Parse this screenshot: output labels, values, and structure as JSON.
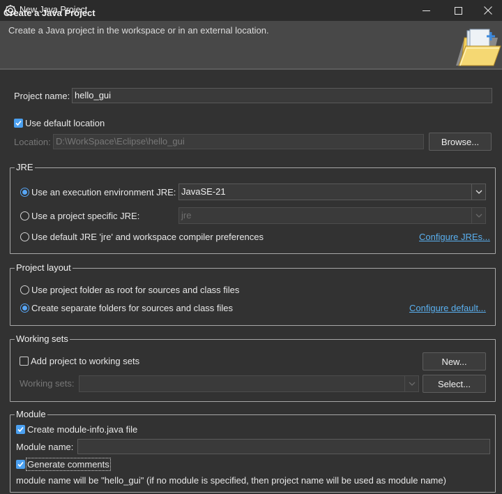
{
  "window": {
    "title": "New Java Project"
  },
  "banner": {
    "title": "Create a Java Project",
    "description": "Create a Java project in the workspace or in an external location."
  },
  "project": {
    "name_label": "Project name:",
    "name_value": "hello_gui"
  },
  "location": {
    "use_default_label": "Use default location",
    "use_default_checked": true,
    "label": "Location:",
    "value": "D:\\WorkSpace\\Eclipse\\hello_gui",
    "browse_label": "Browse..."
  },
  "jre": {
    "legend": "JRE",
    "option_env": "Use an execution environment JRE:",
    "env_value": "JavaSE-21",
    "option_specific": "Use a project specific JRE:",
    "specific_value": "jre",
    "option_default": "Use default JRE 'jre' and workspace compiler preferences",
    "configure_link": "Configure JREs...",
    "selected": "env"
  },
  "layout": {
    "legend": "Project layout",
    "option_root": "Use project folder as root for sources and class files",
    "option_separate": "Create separate folders for sources and class files",
    "configure_link": "Configure default...",
    "selected": "separate"
  },
  "working_sets": {
    "legend": "Working sets",
    "add_label": "Add project to working sets",
    "add_checked": false,
    "new_button": "New...",
    "sets_label": "Working sets:",
    "sets_value": "",
    "select_button": "Select..."
  },
  "module": {
    "legend": "Module",
    "create_label": "Create module-info.java file",
    "create_checked": true,
    "name_label": "Module name:",
    "name_value": "",
    "comments_label": "Generate comments",
    "comments_checked": true,
    "info_text": "module name will be \"hello_gui\"  (if no module is specified, then project name will be used as module name)"
  },
  "colors": {
    "accent": "#58a6f5",
    "link": "#5ab0f0",
    "background": "#323232"
  },
  "icons": [
    "eclipse-app-icon",
    "minimize-icon",
    "maximize-icon",
    "close-icon",
    "folder-wizard-icon",
    "chevron-down-icon",
    "checkmark-icon"
  ]
}
